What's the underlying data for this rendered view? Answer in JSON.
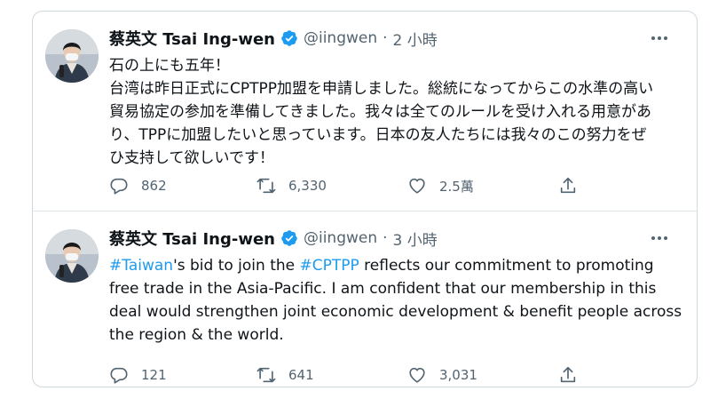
{
  "tweets": [
    {
      "name": "蔡英文 Tsai Ing-wen",
      "handle": "@iingwen",
      "time": "2 小時",
      "lines": [
        "石の上にも五年！",
        "台湾は昨日正式にCPTPP加盟を申請しました。総統になってからこの水準の高い",
        "貿易協定の参加を準備してきました。我々は全てのルールを受け入れる用意があ",
        "り、TPPに加盟したいと思っています。日本の友人たちには我々のこの努力をぜ",
        "ひ支持して欲しいです！"
      ],
      "replies": "862",
      "retweets": "6,330",
      "likes": "2.5萬"
    },
    {
      "name": "蔡英文 Tsai Ing-wen",
      "handle": "@iingwen",
      "time": "3 小時",
      "line1": {
        "hashtag1": "#Taiwan",
        "text1": "'s bid to join the ",
        "hashtag2": "#CPTPP",
        "text2": " reflects our commitment to promoting"
      },
      "lines": [
        "free trade in the Asia-Pacific. I am confident that our membership in this",
        "deal would strengthen joint economic development & benefit people across",
        "the region & the world."
      ],
      "replies": "121",
      "retweets": "641",
      "likes": "3,031"
    }
  ],
  "colors": {
    "verified": "#1d9bf0",
    "hashtag": "#1d9bf0",
    "secondary_text": "#536471",
    "border": "#cfd9de"
  },
  "icons": {
    "reply": "reply-icon",
    "retweet": "retweet-icon",
    "like": "like-icon",
    "share": "share-icon",
    "more": "more-icon",
    "verified": "verified-badge-icon"
  }
}
